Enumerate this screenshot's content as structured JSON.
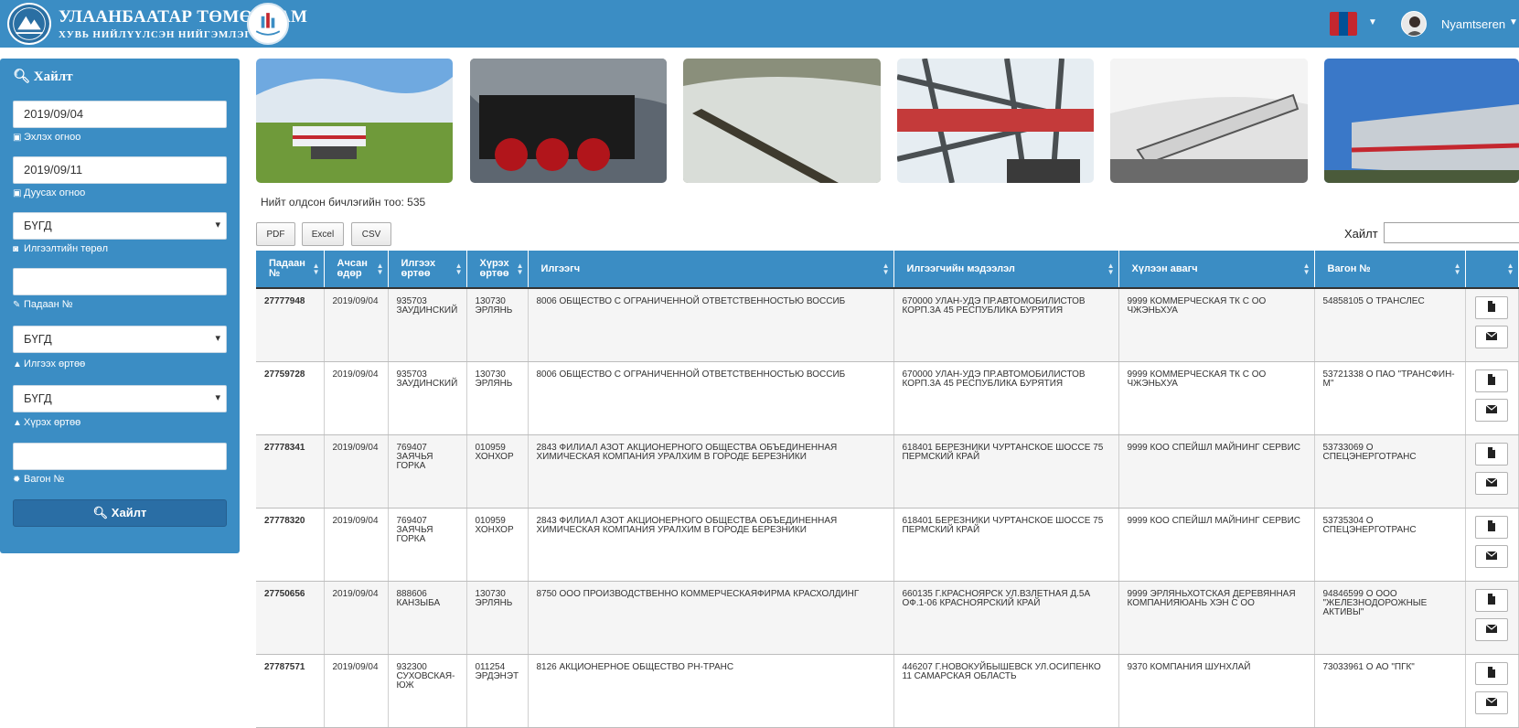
{
  "header": {
    "brand_line1": "УЛААНБААТАР ТӨМӨР ЗАМ",
    "brand_line2": "ХУВЬ НИЙЛҮҮЛСЭН НИЙГЭМЛЭГ",
    "username": "Nyamtseren",
    "flag_colors": [
      "#c4272f",
      "#015197",
      "#c4272f"
    ]
  },
  "sidebar": {
    "title": "Хайлт",
    "start_date": "2019/09/04",
    "start_label": "Эхлэх огноо",
    "end_date": "2019/09/11",
    "end_label": "Дуусах огноо",
    "sender_type_value": "БҮГД",
    "sender_type_label": "Илгээлтийн төрөл",
    "padaan_value": "",
    "padaan_label": "Падаан №",
    "send_station_value": "БҮГД",
    "send_station_label": "Илгээх өртөө",
    "arrive_station_value": "БҮГД",
    "arrive_station_label": "Хүрэх өртөө",
    "wagon_value": "",
    "wagon_label": "Вагон №",
    "search_button": "Хайлт"
  },
  "results": {
    "count_text": "Нийт олдсон бичлэгийн тоо: 535",
    "export_buttons": [
      "PDF",
      "Excel",
      "CSV"
    ],
    "search_label": "Хайлт",
    "search_value": ""
  },
  "table": {
    "columns": [
      "Падаан №",
      "Ачсан өдөр",
      "Илгээх өртөө",
      "Хүрэх өртөө",
      "Илгээгч",
      "Илгээгчийн мэдээлэл",
      "Хүлээн авагч",
      "Вагон №",
      ""
    ],
    "rows": [
      [
        "27777948",
        "2019/09/04",
        "935703 ЗАУДИНСКИЙ",
        "130730 ЭРЛЯНЬ",
        "8006 ОБЩЕСТВО С ОГРАНИЧЕННОЙ ОТВЕТСТВЕННОСТЬЮ ВОССИБ",
        "670000 УЛАН-УДЭ ПР.АВТОМОБИЛИСТОВ КОРП.3А 45 РЕСПУБЛИКА БУРЯТИЯ",
        "9999 КОММЕРЧЕСКАЯ ТК С ОО ЧЖЭНЬХУА",
        "54858105 О ТРАНСЛЕС"
      ],
      [
        "27759728",
        "2019/09/04",
        "935703 ЗАУДИНСКИЙ",
        "130730 ЭРЛЯНЬ",
        "8006 ОБЩЕСТВО С ОГРАНИЧЕННОЙ ОТВЕТСТВЕННОСТЬЮ ВОССИБ",
        "670000 УЛАН-УДЭ ПР.АВТОМОБИЛИСТОВ КОРП.3А 45 РЕСПУБЛИКА БУРЯТИЯ",
        "9999 КОММЕРЧЕСКАЯ ТК С ОО ЧЖЭНЬХУА",
        "53721338 О ПАО \"ТРАНСФИН-М\""
      ],
      [
        "27778341",
        "2019/09/04",
        "769407 ЗАЯЧЬЯ ГОРКА",
        "010959 ХОНХОР",
        "2843 ФИЛИАЛ АЗОТ АКЦИОНЕРНОГО ОБЩЕСТВА ОБЪЕДИНЕННАЯ ХИМИЧЕСКАЯ КОМПАНИЯ УРАЛХИМ В ГОРОДЕ БЕРЕЗНИКИ",
        "618401 БЕРЕЗНИКИ ЧУРТАНСКОЕ ШОССЕ 75 ПЕРМСКИЙ КРАЙ",
        "9999 КОО СПЕЙШЛ МАЙНИНГ СЕРВИС",
        "53733069 О СПЕЦЭНЕРГОТРАНС"
      ],
      [
        "27778320",
        "2019/09/04",
        "769407 ЗАЯЧЬЯ ГОРКА",
        "010959 ХОНХОР",
        "2843 ФИЛИАЛ АЗОТ АКЦИОНЕРНОГО ОБЩЕСТВА ОБЪЕДИНЕННАЯ ХИМИЧЕСКАЯ КОМПАНИЯ УРАЛХИМ В ГОРОДЕ БЕРЕЗНИКИ",
        "618401 БЕРЕЗНИКИ ЧУРТАНСКОЕ ШОССЕ 75 ПЕРМСКИЙ КРАЙ",
        "9999 КОО СПЕЙШЛ МАЙНИНГ СЕРВИС",
        "53735304 О СПЕЦЭНЕРГОТРАНС"
      ],
      [
        "27750656",
        "2019/09/04",
        "888606 КАНЗЫБА",
        "130730 ЭРЛЯНЬ",
        "8750 ООО ПРОИЗВОДСТВЕННО КОММЕРЧЕСКАЯФИРМА КРАСХОЛДИНГ",
        "660135 Г.КРАСНОЯРСК УЛ.ВЗЛЕТНАЯ Д.5А ОФ.1-06 КРАСНОЯРСКИЙ КРАЙ",
        "9999 ЭРЛЯНЬХОТСКАЯ ДЕРЕВЯННАЯ КОМПАНИЯЮАНЬ ХЭН С ОО",
        "94846599 О ООО \"ЖЕЛЕЗНОДОРОЖНЫЕ АКТИВЫ\""
      ],
      [
        "27787571",
        "2019/09/04",
        "932300 СУХОВСКАЯ-ЮЖ",
        "011254 ЭРДЭНЭТ",
        "8126 АКЦИОНЕРНОЕ ОБЩЕСТВО РН-ТРАНС",
        "446207 Г.НОВОКУЙБЫШЕВСК УЛ.ОСИПЕНКО 11 САМАРСКАЯ ОБЛАСТЬ",
        "9370 КОМПАНИЯ ШУНХЛАЙ",
        "73033961 О АО \"ПГК\""
      ]
    ]
  }
}
